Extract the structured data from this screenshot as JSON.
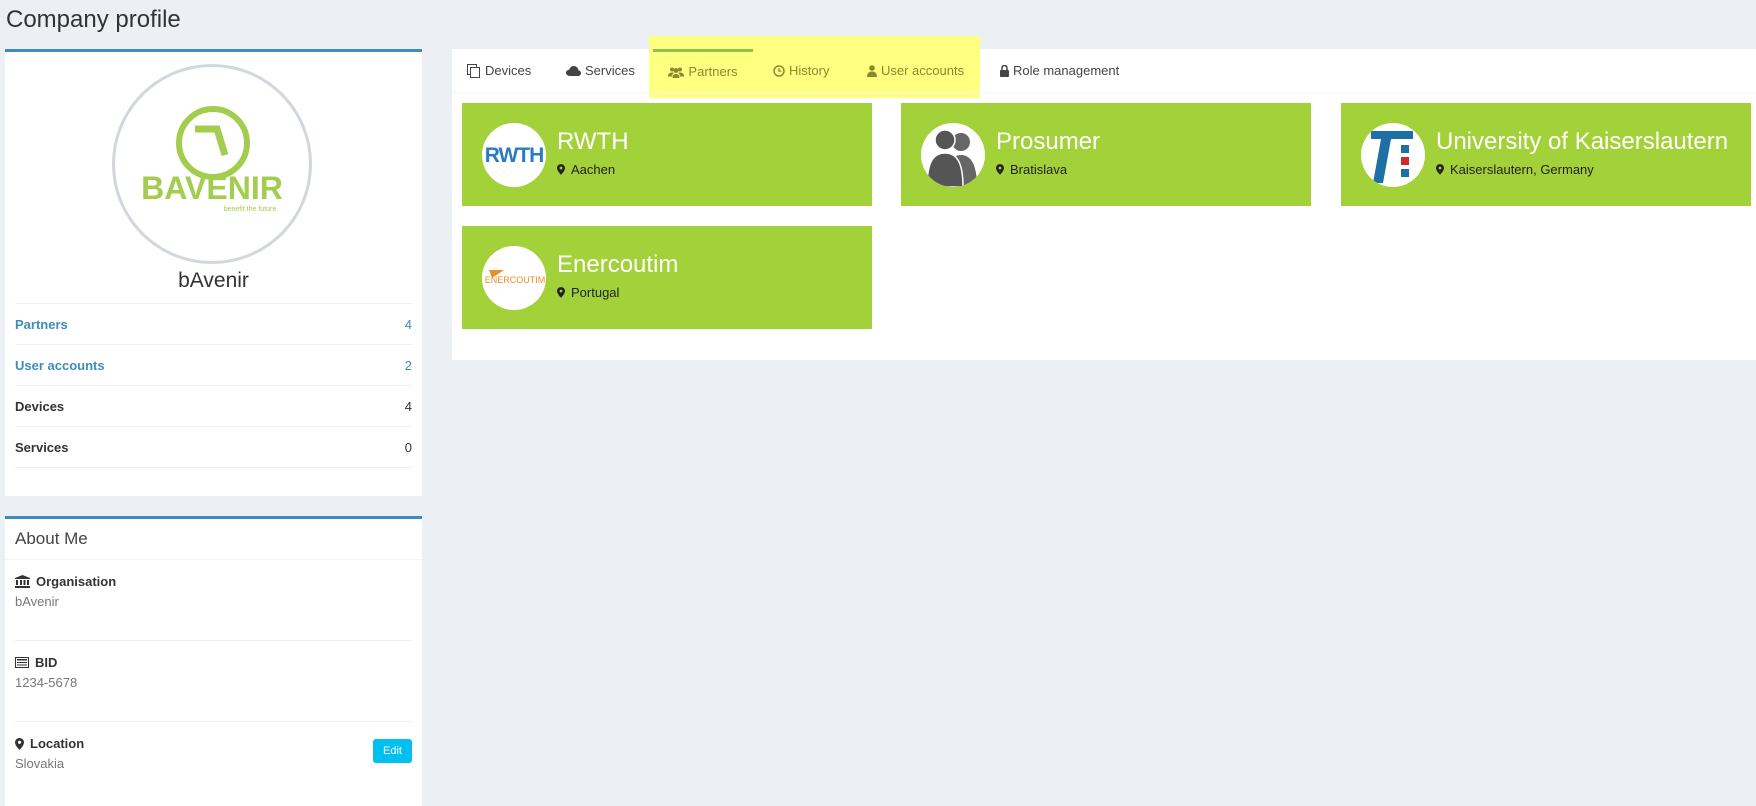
{
  "page": {
    "title": "Company profile"
  },
  "profile": {
    "company_name": "bAvenir",
    "logo_text": "BAVENIR",
    "logo_tagline": "benefit the future",
    "stats": [
      {
        "label": "Partners",
        "value": "4",
        "link": true
      },
      {
        "label": "User accounts",
        "value": "2",
        "link": true
      },
      {
        "label": "Devices",
        "value": "4",
        "link": false
      },
      {
        "label": "Services",
        "value": "0",
        "link": false
      }
    ]
  },
  "about": {
    "title": "About Me",
    "organisation_label": "Organisation",
    "organisation_value": "bAvenir",
    "bid_label": "BID",
    "bid_value": "1234-5678",
    "location_label": "Location",
    "location_value": "Slovakia",
    "edit_label": "Edit"
  },
  "tabs": [
    {
      "label": "Devices",
      "icon": "copy-icon"
    },
    {
      "label": "Services",
      "icon": "cloud-icon"
    },
    {
      "label": "Partners",
      "icon": "users-icon",
      "active": true
    },
    {
      "label": "History",
      "icon": "clock-icon"
    },
    {
      "label": "User accounts",
      "icon": "user-icon"
    },
    {
      "label": "Role management",
      "icon": "lock-icon"
    }
  ],
  "partners": [
    {
      "name": "RWTH",
      "location": "Aachen",
      "logo_text": "RWTH"
    },
    {
      "name": "Prosumer",
      "location": "Bratislava"
    },
    {
      "name": "University of Kaiserslautern",
      "location": "Kaiserslautern, Germany"
    },
    {
      "name": "Enercoutim",
      "location": "Portugal",
      "logo_text": "ENERCOUTIM"
    }
  ],
  "colors": {
    "accent": "#3c8dbc",
    "card_green": "#a3d13a",
    "tab_active_border": "#8fc24a",
    "highlight": "#ffff80",
    "edit_button": "#00c0ef"
  }
}
